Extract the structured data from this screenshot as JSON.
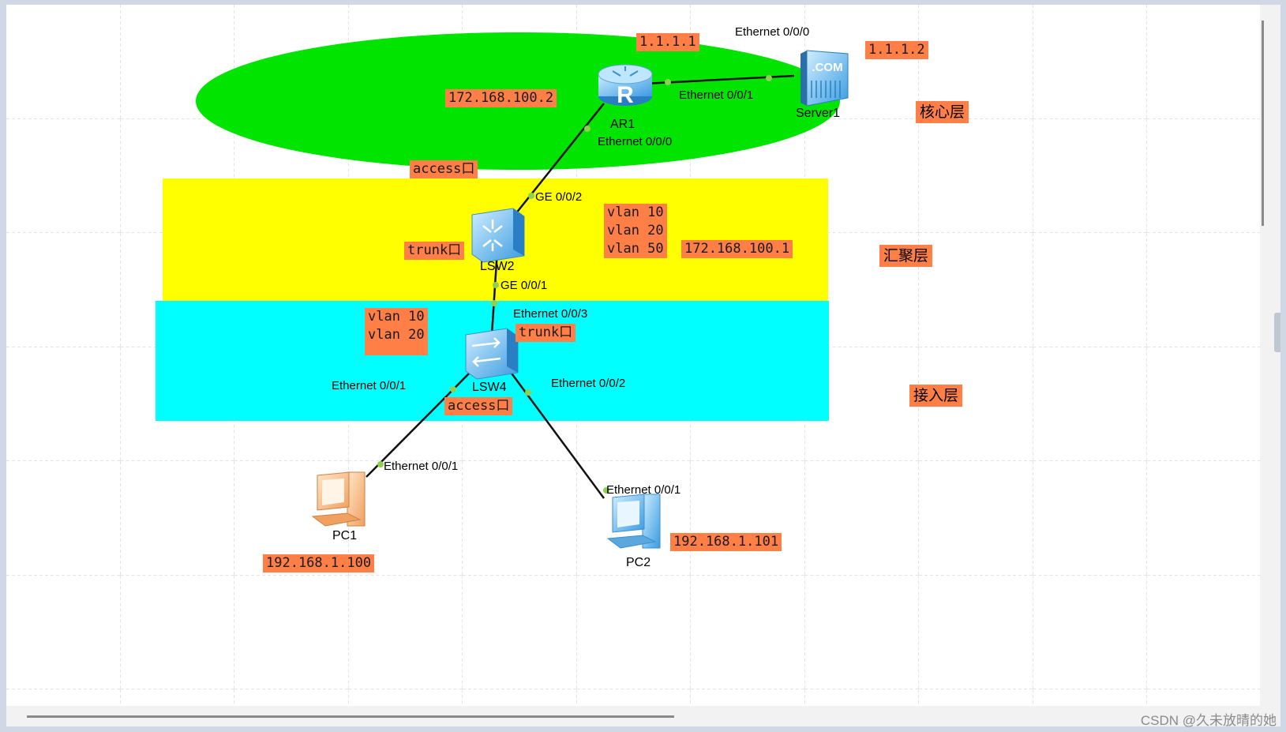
{
  "zones": [
    {
      "name": "core-zone",
      "color": "#00e400"
    },
    {
      "name": "aggregation-zone",
      "color": "#ffff00"
    },
    {
      "name": "access-zone",
      "color": "#00ffff"
    }
  ],
  "layers": {
    "core": "核心层",
    "aggregation": "汇聚层",
    "access": "接入层"
  },
  "devices": {
    "ar1": {
      "name": "AR1",
      "icon": "router-icon"
    },
    "server1": {
      "name": "Server1",
      "icon": "server-icon"
    },
    "lsw2": {
      "name": "LSW2",
      "icon": "l3-switch-icon"
    },
    "lsw4": {
      "name": "LSW4",
      "icon": "switch-icon"
    },
    "pc1": {
      "name": "PC1",
      "icon": "pc-icon"
    },
    "pc2": {
      "name": "PC2",
      "icon": "pc-icon"
    }
  },
  "ports": {
    "server_e000": "Ethernet 0/0/0",
    "ar1_e001": "Ethernet 0/0/1",
    "ar1_e000": "Ethernet 0/0/0",
    "lsw2_ge002": "GE 0/0/2",
    "lsw2_ge001": "GE 0/0/1",
    "lsw4_e003": "Ethernet 0/0/3",
    "lsw4_e001": "Ethernet 0/0/1",
    "lsw4_e002": "Ethernet 0/0/2",
    "pc1_e001": "Ethernet 0/0/1",
    "pc2_e001": "Ethernet 0/0/1"
  },
  "labels": {
    "ar1_ip": "1.1.1.1",
    "server_ip": "1.1.1.2",
    "ar1_inner_ip": "172.168.100.2",
    "access_port_top": "access口",
    "trunk_port_lsw2": "trunk口",
    "lsw2_vlans": "vlan 10\nvlan 20\nvlan 50",
    "lsw2_ip": "172.168.100.1",
    "lsw4_vlans": "vlan 10\nvlan 20",
    "trunk_port_lsw4": "trunk口",
    "access_port_bottom": "access口",
    "pc1_ip": "192.168.1.100",
    "pc2_ip": "192.168.1.101"
  },
  "watermark": "CSDN @久未放晴的她"
}
